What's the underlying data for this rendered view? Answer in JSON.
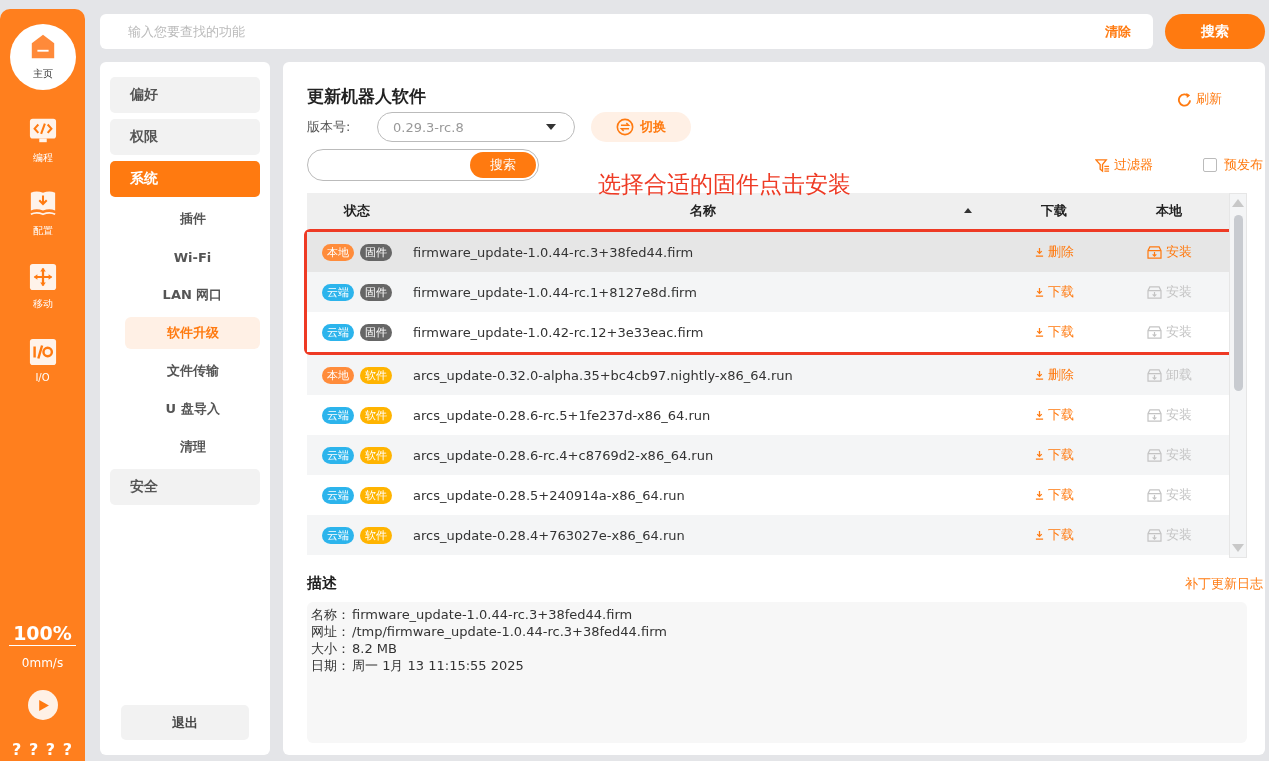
{
  "rail": {
    "items": [
      {
        "label": "主页",
        "selected": true
      },
      {
        "label": "编程",
        "selected": false
      },
      {
        "label": "配置",
        "selected": false
      },
      {
        "label": "移动",
        "selected": false
      },
      {
        "label": "I/O",
        "selected": false
      }
    ],
    "speed_percent": "100%",
    "speed": "0mm/s",
    "footer": "? ? ? ?"
  },
  "search": {
    "placeholder": "输入您要查找的功能",
    "clear": "清除",
    "button": "搜索"
  },
  "nav": {
    "items": [
      {
        "label": "偏好",
        "selected": false
      },
      {
        "label": "权限",
        "selected": false
      },
      {
        "label": "系统",
        "selected": true,
        "children": [
          {
            "label": "插件",
            "selected": false
          },
          {
            "label": "Wi-Fi",
            "selected": false
          },
          {
            "label": "LAN 网口",
            "selected": false
          },
          {
            "label": "软件升级",
            "selected": true
          },
          {
            "label": "文件传输",
            "selected": false
          },
          {
            "label": "U 盘导入",
            "selected": false
          },
          {
            "label": "清理",
            "selected": false
          }
        ]
      },
      {
        "label": "安全",
        "selected": false
      }
    ],
    "logout": "退出"
  },
  "panel": {
    "title": "更新机器人软件",
    "refresh": "刷新",
    "version_label": "版本号:",
    "version_value": "0.29.3-rc.8",
    "switch": "切换",
    "search_button": "搜索",
    "filter": "过滤器",
    "prerelease": {
      "label": "预发布",
      "checked": false
    },
    "annotation": "选择合适的固件点击安装",
    "table": {
      "columns": [
        "状态",
        "名称",
        "下载",
        "本地"
      ],
      "rows": [
        {
          "status": {
            "label": "本地",
            "color": "#ff8c3b"
          },
          "type": {
            "label": "固件",
            "color": "#666666"
          },
          "name": "firmware_update-1.0.44-rc.3+38fed44.firm",
          "download": "删除",
          "install": {
            "label": "安装",
            "disabled": false
          },
          "selected": true,
          "annotated": true
        },
        {
          "status": {
            "label": "云端",
            "color": "#2cb4ec"
          },
          "type": {
            "label": "固件",
            "color": "#666666"
          },
          "name": "firmware_update-1.0.44-rc.1+8127e8d.firm",
          "download": "下载",
          "install": {
            "label": "安装",
            "disabled": true
          },
          "selected": false,
          "annotated": true
        },
        {
          "status": {
            "label": "云端",
            "color": "#2cb4ec"
          },
          "type": {
            "label": "固件",
            "color": "#666666"
          },
          "name": "firmware_update-1.0.42-rc.12+3e33eac.firm",
          "download": "下载",
          "install": {
            "label": "安装",
            "disabled": true
          },
          "selected": false,
          "annotated": true
        },
        {
          "status": {
            "label": "本地",
            "color": "#ff8c3b"
          },
          "type": {
            "label": "软件",
            "color": "#ffb400"
          },
          "name": "arcs_update-0.32.0-alpha.35+bc4cb97.nightly-x86_64.run",
          "download": "删除",
          "install": {
            "label": "卸载",
            "disabled": true
          },
          "selected": false,
          "annotated": false
        },
        {
          "status": {
            "label": "云端",
            "color": "#2cb4ec"
          },
          "type": {
            "label": "软件",
            "color": "#ffb400"
          },
          "name": "arcs_update-0.28.6-rc.5+1fe237d-x86_64.run",
          "download": "下载",
          "install": {
            "label": "安装",
            "disabled": true
          },
          "selected": false,
          "annotated": false
        },
        {
          "status": {
            "label": "云端",
            "color": "#2cb4ec"
          },
          "type": {
            "label": "软件",
            "color": "#ffb400"
          },
          "name": "arcs_update-0.28.6-rc.4+c8769d2-x86_64.run",
          "download": "下载",
          "install": {
            "label": "安装",
            "disabled": true
          },
          "selected": false,
          "annotated": false
        },
        {
          "status": {
            "label": "云端",
            "color": "#2cb4ec"
          },
          "type": {
            "label": "软件",
            "color": "#ffb400"
          },
          "name": "arcs_update-0.28.5+240914a-x86_64.run",
          "download": "下载",
          "install": {
            "label": "安装",
            "disabled": true
          },
          "selected": false,
          "annotated": false
        },
        {
          "status": {
            "label": "云端",
            "color": "#2cb4ec"
          },
          "type": {
            "label": "软件",
            "color": "#ffb400"
          },
          "name": "arcs_update-0.28.4+763027e-x86_64.run",
          "download": "下载",
          "install": {
            "label": "安装",
            "disabled": true
          },
          "selected": false,
          "annotated": false
        }
      ]
    },
    "description": {
      "title": "描述",
      "changelog": "补丁更新日志",
      "lines": [
        {
          "label": "名称：",
          "value": "firmware_update-1.0.44-rc.3+38fed44.firm"
        },
        {
          "label": "网址：",
          "value": "/tmp/firmware_update-1.0.44-rc.3+38fed44.firm"
        },
        {
          "label": "大小：",
          "value": "8.2 MB"
        },
        {
          "label": "日期：",
          "value": "周一 1月 13 11:15:55 2025"
        }
      ]
    }
  }
}
